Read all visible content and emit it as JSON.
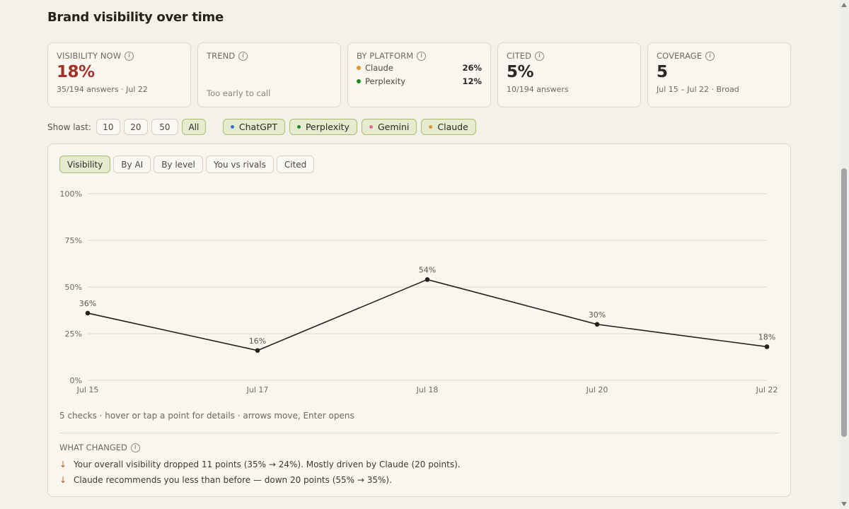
{
  "page": {
    "title": "Brand visibility over time"
  },
  "cards": {
    "visibility": {
      "title": "VISIBILITY NOW",
      "value": "18%",
      "sub": "35/194 answers · Jul 22"
    },
    "trend": {
      "title": "TREND",
      "text": "Too early to call"
    },
    "platform": {
      "title": "BY PLATFORM",
      "rows": [
        {
          "name": "Claude",
          "value": "26%",
          "color": "#e0952f"
        },
        {
          "name": "Perplexity",
          "value": "12%",
          "color": "#1c8a1c"
        }
      ]
    },
    "cited": {
      "title": "CITED",
      "value": "5%",
      "sub": "10/194 answers"
    },
    "coverage": {
      "title": "COVERAGE",
      "value": "5",
      "sub": "Jul 15 – Jul 22 · Broad"
    }
  },
  "filters": {
    "show_last_label": "Show last:",
    "options": [
      "10",
      "20",
      "50",
      "All"
    ],
    "selected": "All",
    "platforms": [
      {
        "name": "ChatGPT",
        "color": "#3b6fd8"
      },
      {
        "name": "Perplexity",
        "color": "#1c8a1c"
      },
      {
        "name": "Gemini",
        "color": "#e26b9a"
      },
      {
        "name": "Claude",
        "color": "#e0952f"
      }
    ]
  },
  "tabs": [
    "Visibility",
    "By AI",
    "By level",
    "You vs rivals",
    "Cited"
  ],
  "active_tab": "Visibility",
  "chart_data": {
    "type": "line",
    "x": [
      "Jul 15",
      "Jul 17",
      "Jul 18",
      "Jul 20",
      "Jul 22"
    ],
    "series": [
      {
        "values": [
          36,
          16,
          54,
          30,
          18
        ],
        "labels": [
          "36%",
          "16%",
          "54%",
          "30%",
          "18%"
        ]
      }
    ],
    "ylim": [
      0,
      100
    ],
    "yticks": [
      "0%",
      "25%",
      "50%",
      "75%",
      "100%"
    ],
    "grid": true,
    "line_color": "#25221c"
  },
  "hint": "5 checks · hover or tap a point for details · arrows move, Enter opens",
  "what_changed": {
    "title": "WHAT CHANGED",
    "items": [
      {
        "arrow": "↓",
        "text": "Your overall visibility dropped 11 points (35% → 24%). Mostly driven by Claude (20 points)."
      },
      {
        "arrow": "↓",
        "text": "Claude recommends you less than before — down 20 points (55% → 35%)."
      }
    ]
  }
}
